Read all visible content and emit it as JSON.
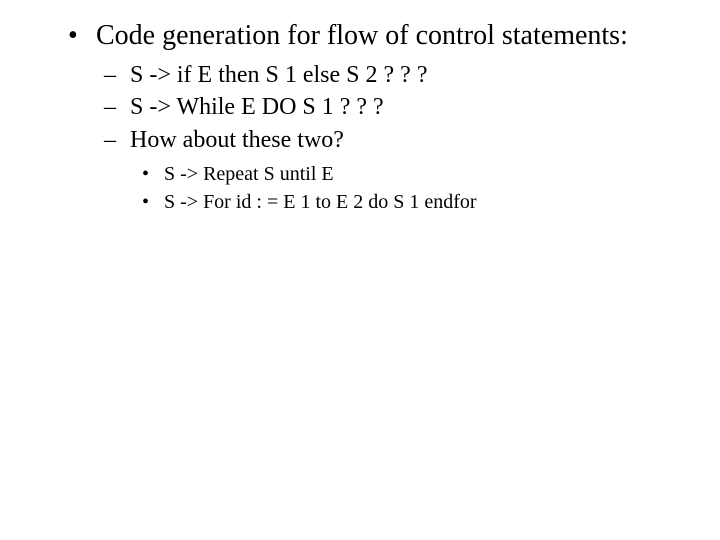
{
  "slide": {
    "bullets": [
      {
        "text": "Code generation for flow of control statements:",
        "children": [
          {
            "text": "S -> if E then S 1 else S 2 ? ? ?"
          },
          {
            "text": "S -> While E DO S 1    ? ? ?"
          },
          {
            "text": "How about these two?",
            "children": [
              {
                "text": "S -> Repeat S until E"
              },
              {
                "text": "S -> For id : = E 1 to E 2 do S 1 endfor"
              }
            ]
          }
        ]
      }
    ]
  }
}
